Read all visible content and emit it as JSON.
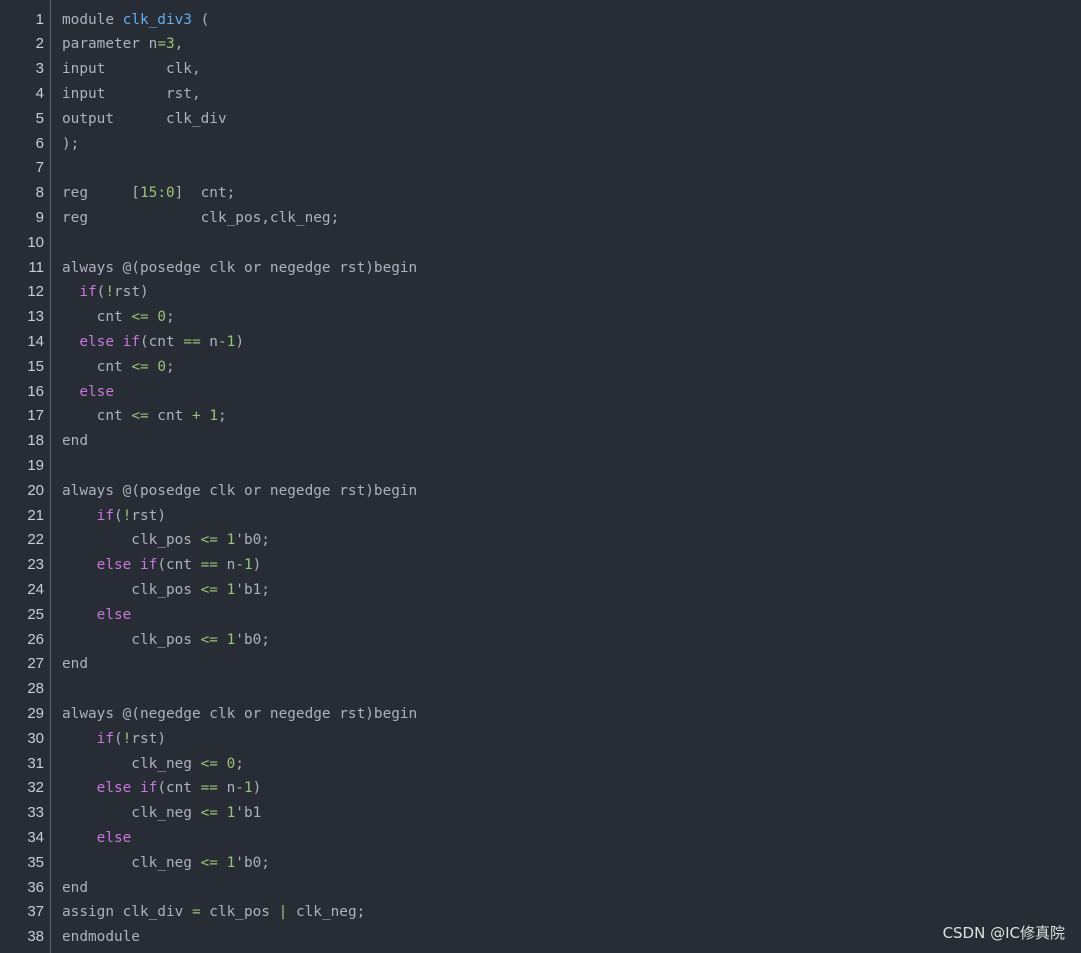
{
  "lines": [
    [
      {
        "t": "module ",
        "c": "plain"
      },
      {
        "t": "clk_div3",
        "c": "fn"
      },
      {
        "t": " (",
        "c": "plain"
      }
    ],
    [
      {
        "t": "parameter n",
        "c": "plain"
      },
      {
        "t": "=",
        "c": "op"
      },
      {
        "t": "3",
        "c": "num"
      },
      {
        "t": ",",
        "c": "plain"
      }
    ],
    [
      {
        "t": "input       clk,",
        "c": "plain"
      }
    ],
    [
      {
        "t": "input       rst,",
        "c": "plain"
      }
    ],
    [
      {
        "t": "output      clk_div",
        "c": "plain"
      }
    ],
    [
      {
        "t": ");",
        "c": "plain"
      }
    ],
    [],
    [
      {
        "t": "reg     [",
        "c": "plain"
      },
      {
        "t": "15",
        "c": "num"
      },
      {
        "t": ":",
        "c": "op"
      },
      {
        "t": "0",
        "c": "num"
      },
      {
        "t": "]  cnt;",
        "c": "plain"
      }
    ],
    [
      {
        "t": "reg             clk_pos,clk_neg;",
        "c": "plain"
      }
    ],
    [],
    [
      {
        "t": "always @(posedge clk or negedge rst)begin",
        "c": "plain"
      }
    ],
    [
      {
        "t": "  ",
        "c": "plain"
      },
      {
        "t": "if",
        "c": "kw"
      },
      {
        "t": "(",
        "c": "plain"
      },
      {
        "t": "!",
        "c": "op"
      },
      {
        "t": "rst)",
        "c": "plain"
      }
    ],
    [
      {
        "t": "    cnt ",
        "c": "plain"
      },
      {
        "t": "<=",
        "c": "op"
      },
      {
        "t": " ",
        "c": "plain"
      },
      {
        "t": "0",
        "c": "num"
      },
      {
        "t": ";",
        "c": "plain"
      }
    ],
    [
      {
        "t": "  ",
        "c": "plain"
      },
      {
        "t": "else if",
        "c": "kw"
      },
      {
        "t": "(cnt ",
        "c": "plain"
      },
      {
        "t": "==",
        "c": "op"
      },
      {
        "t": " n",
        "c": "plain"
      },
      {
        "t": "-",
        "c": "op"
      },
      {
        "t": "1",
        "c": "num"
      },
      {
        "t": ")",
        "c": "plain"
      }
    ],
    [
      {
        "t": "    cnt ",
        "c": "plain"
      },
      {
        "t": "<=",
        "c": "op"
      },
      {
        "t": " ",
        "c": "plain"
      },
      {
        "t": "0",
        "c": "num"
      },
      {
        "t": ";",
        "c": "plain"
      }
    ],
    [
      {
        "t": "  ",
        "c": "plain"
      },
      {
        "t": "else",
        "c": "kw"
      }
    ],
    [
      {
        "t": "    cnt ",
        "c": "plain"
      },
      {
        "t": "<=",
        "c": "op"
      },
      {
        "t": " cnt ",
        "c": "plain"
      },
      {
        "t": "+",
        "c": "op"
      },
      {
        "t": " ",
        "c": "plain"
      },
      {
        "t": "1",
        "c": "num"
      },
      {
        "t": ";",
        "c": "plain"
      }
    ],
    [
      {
        "t": "end",
        "c": "plain"
      }
    ],
    [],
    [
      {
        "t": "always @(posedge clk or negedge rst)begin",
        "c": "plain"
      }
    ],
    [
      {
        "t": "    ",
        "c": "plain"
      },
      {
        "t": "if",
        "c": "kw"
      },
      {
        "t": "(",
        "c": "plain"
      },
      {
        "t": "!",
        "c": "op"
      },
      {
        "t": "rst)",
        "c": "plain"
      }
    ],
    [
      {
        "t": "        clk_pos ",
        "c": "plain"
      },
      {
        "t": "<=",
        "c": "op"
      },
      {
        "t": " ",
        "c": "plain"
      },
      {
        "t": "1",
        "c": "num"
      },
      {
        "t": "'b0;",
        "c": "plain"
      }
    ],
    [
      {
        "t": "    ",
        "c": "plain"
      },
      {
        "t": "else if",
        "c": "kw"
      },
      {
        "t": "(cnt ",
        "c": "plain"
      },
      {
        "t": "==",
        "c": "op"
      },
      {
        "t": " n",
        "c": "plain"
      },
      {
        "t": "-",
        "c": "op"
      },
      {
        "t": "1",
        "c": "num"
      },
      {
        "t": ")",
        "c": "plain"
      }
    ],
    [
      {
        "t": "        clk_pos ",
        "c": "plain"
      },
      {
        "t": "<=",
        "c": "op"
      },
      {
        "t": " ",
        "c": "plain"
      },
      {
        "t": "1",
        "c": "num"
      },
      {
        "t": "'b1;",
        "c": "plain"
      }
    ],
    [
      {
        "t": "    ",
        "c": "plain"
      },
      {
        "t": "else",
        "c": "kw"
      }
    ],
    [
      {
        "t": "        clk_pos ",
        "c": "plain"
      },
      {
        "t": "<=",
        "c": "op"
      },
      {
        "t": " ",
        "c": "plain"
      },
      {
        "t": "1",
        "c": "num"
      },
      {
        "t": "'b0;",
        "c": "plain"
      }
    ],
    [
      {
        "t": "end",
        "c": "plain"
      }
    ],
    [],
    [
      {
        "t": "always @(negedge clk or negedge rst)begin",
        "c": "plain"
      }
    ],
    [
      {
        "t": "    ",
        "c": "plain"
      },
      {
        "t": "if",
        "c": "kw"
      },
      {
        "t": "(",
        "c": "plain"
      },
      {
        "t": "!",
        "c": "op"
      },
      {
        "t": "rst)",
        "c": "plain"
      }
    ],
    [
      {
        "t": "        clk_neg ",
        "c": "plain"
      },
      {
        "t": "<=",
        "c": "op"
      },
      {
        "t": " ",
        "c": "plain"
      },
      {
        "t": "0",
        "c": "num"
      },
      {
        "t": ";",
        "c": "plain"
      }
    ],
    [
      {
        "t": "    ",
        "c": "plain"
      },
      {
        "t": "else if",
        "c": "kw"
      },
      {
        "t": "(cnt ",
        "c": "plain"
      },
      {
        "t": "==",
        "c": "op"
      },
      {
        "t": " n",
        "c": "plain"
      },
      {
        "t": "-",
        "c": "op"
      },
      {
        "t": "1",
        "c": "num"
      },
      {
        "t": ")",
        "c": "plain"
      }
    ],
    [
      {
        "t": "        clk_neg ",
        "c": "plain"
      },
      {
        "t": "<=",
        "c": "op"
      },
      {
        "t": " ",
        "c": "plain"
      },
      {
        "t": "1",
        "c": "num"
      },
      {
        "t": "'b1",
        "c": "plain"
      }
    ],
    [
      {
        "t": "    ",
        "c": "plain"
      },
      {
        "t": "else",
        "c": "kw"
      }
    ],
    [
      {
        "t": "        clk_neg ",
        "c": "plain"
      },
      {
        "t": "<=",
        "c": "op"
      },
      {
        "t": " ",
        "c": "plain"
      },
      {
        "t": "1",
        "c": "num"
      },
      {
        "t": "'b0;",
        "c": "plain"
      }
    ],
    [
      {
        "t": "end",
        "c": "plain"
      }
    ],
    [
      {
        "t": "assign clk_div ",
        "c": "plain"
      },
      {
        "t": "=",
        "c": "op"
      },
      {
        "t": " clk_pos ",
        "c": "plain"
      },
      {
        "t": "|",
        "c": "op"
      },
      {
        "t": " clk_neg;",
        "c": "plain"
      }
    ],
    [
      {
        "t": "endmodule",
        "c": "plain"
      }
    ]
  ],
  "watermark": "CSDN @IC修真院",
  "colors": {
    "background": "#282c34",
    "plain": "#abb2bf",
    "keyword": "#c678dd",
    "function": "#61afef",
    "number": "#98c379",
    "operator": "#98c379",
    "line_number": "#c8ccd4"
  }
}
